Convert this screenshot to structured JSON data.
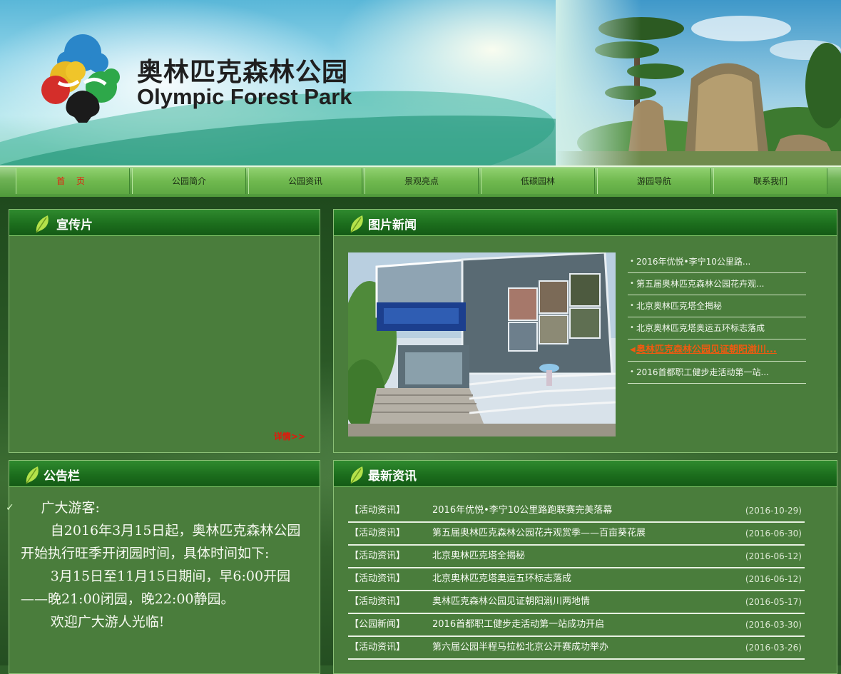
{
  "header": {
    "title_cn": "奥林匹克森林公园",
    "title_en": "Olympic Forest Park"
  },
  "nav": {
    "items": [
      {
        "label": "首  页",
        "active": true
      },
      {
        "label": "公园简介"
      },
      {
        "label": "公园资讯"
      },
      {
        "label": "景观亮点"
      },
      {
        "label": "低碳园林"
      },
      {
        "label": "游园导航"
      },
      {
        "label": "联系我们"
      }
    ]
  },
  "video_panel": {
    "title": "宣传片",
    "more": "详情>>"
  },
  "photo_news": {
    "title": "图片新闻",
    "items": [
      "2016年优悦•李宁10公里路...",
      "第五届奥林匹克森林公园花卉观...",
      "北京奥林匹克塔全揭秘",
      "北京奥林匹克塔奥运五环标志落成",
      "奥林匹克森林公园见证朝阳湔川...",
      "2016首都职工健步走活动第一站..."
    ],
    "highlight_index": 4
  },
  "notice": {
    "title": "公告栏",
    "greeting": "广大游客:",
    "p1": "自2016年3月15日起，奥林匹克森林公园开始执行旺季开闭园时间，具体时间如下:",
    "p2": "3月15日至11月15日期间，早6:00开园——晚21:00闭园，晚22:00静园。",
    "p3": "欢迎广大游人光临!"
  },
  "latest": {
    "title": "最新资讯",
    "rows": [
      {
        "cat": "【活动资讯】",
        "title": "2016年优悦•李宁10公里路跑联赛完美落幕",
        "date": "(2016-10-29)"
      },
      {
        "cat": "【活动资讯】",
        "title": "第五届奥林匹克森林公园花卉观赏季——百亩葵花展",
        "date": "(2016-06-30)"
      },
      {
        "cat": "【活动资讯】",
        "title": "北京奥林匹克塔全揭秘",
        "date": "(2016-06-12)"
      },
      {
        "cat": "【活动资讯】",
        "title": "北京奥林匹克塔奥运五环标志落成",
        "date": "(2016-06-12)"
      },
      {
        "cat": "【活动资讯】",
        "title": "奥林匹克森林公园见证朝阳湔川两地情",
        "date": "(2016-05-17)"
      },
      {
        "cat": "【公园新闻】",
        "title": "2016首都职工健步走活动第一站成功开启",
        "date": "(2016-03-30)"
      },
      {
        "cat": "【活动资讯】",
        "title": "第六届公园半程马拉松北京公开赛成功举办",
        "date": "(2016-03-26)"
      }
    ]
  },
  "colors": {
    "accent_red": "#e8190d",
    "highlight_orange": "#f05a10",
    "panel_green": "#4a7d3c",
    "header_green": "#1c6e1d"
  }
}
